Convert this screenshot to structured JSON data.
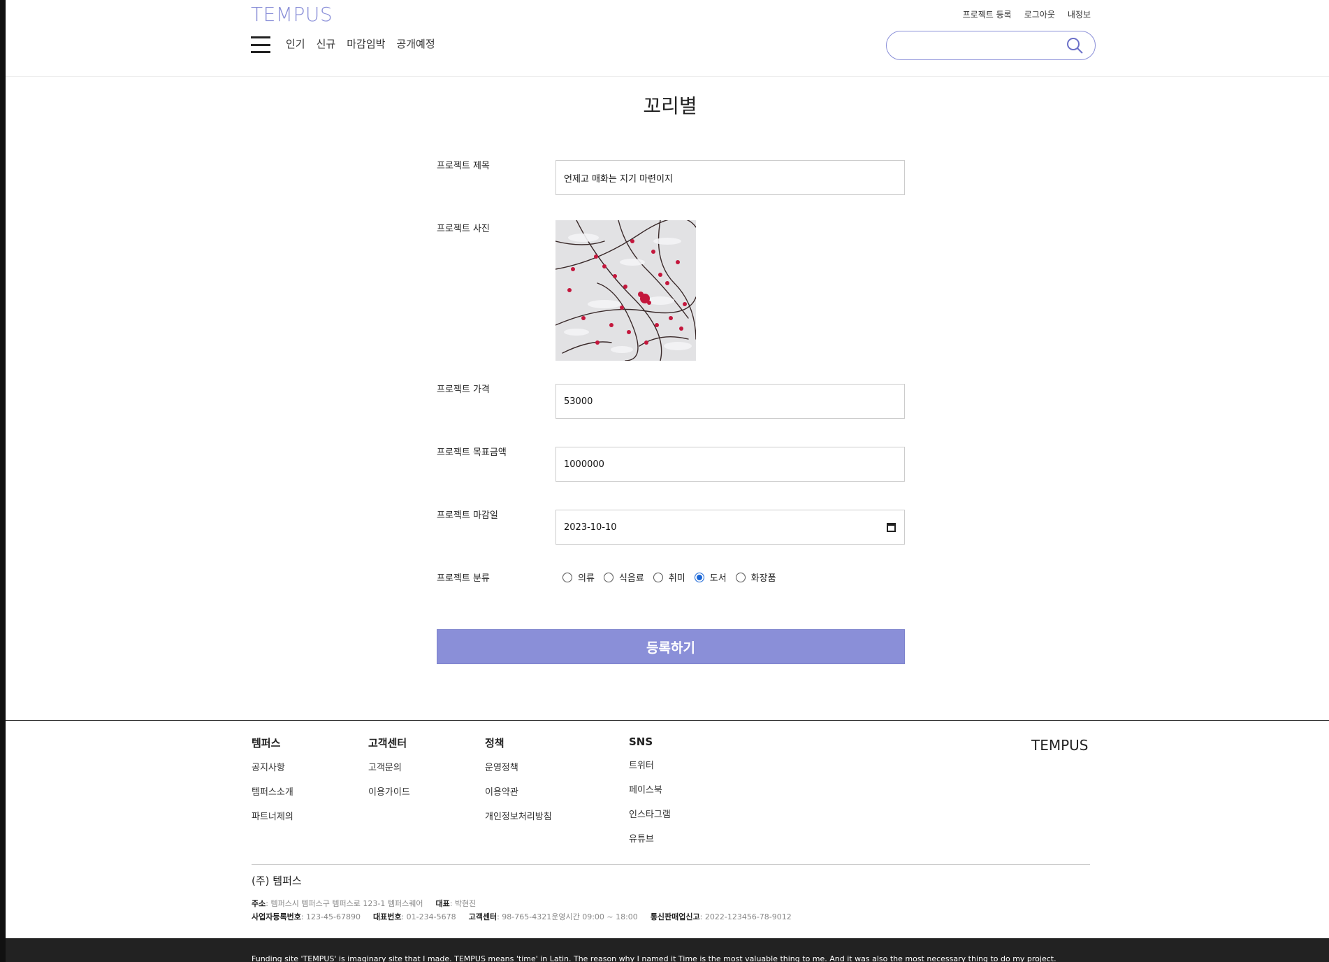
{
  "header": {
    "logo": "TEMPUS",
    "util_links": [
      "프로젝트 등록",
      "로그아웃",
      "내정보"
    ],
    "nav": [
      "인기",
      "신규",
      "마감임박",
      "공개예정"
    ],
    "search_placeholder": ""
  },
  "form": {
    "page_title": "꼬리별",
    "title_label": "프로젝트 제목",
    "title_value": "언제고 매화는 지기 마련이지",
    "photo_label": "프로젝트 사진",
    "price_label": "프로젝트 가격",
    "price_value": "53000",
    "goal_label": "프로젝트 목표금액",
    "goal_value": "1000000",
    "deadline_label": "프로젝트 마감일",
    "deadline_value": "2023-10-10",
    "category_label": "프로젝트 분류",
    "categories": [
      "의류",
      "식음료",
      "취미",
      "도서",
      "화장품"
    ],
    "selected_category": "도서",
    "submit_label": "등록하기"
  },
  "footer": {
    "columns": [
      {
        "title": "템퍼스",
        "items": [
          "공지사항",
          "템퍼스소개",
          "파트너제의"
        ]
      },
      {
        "title": "고객센터",
        "items": [
          "고객문의",
          "이용가이드"
        ]
      },
      {
        "title": "정책",
        "items": [
          "운영정책",
          "이용약관",
          "개인정보처리방침"
        ]
      },
      {
        "title": "SNS",
        "items": [
          "트위터",
          "페이스북",
          "인스타그램",
          "유튜브"
        ]
      }
    ],
    "logo": "TEMPUS",
    "company": "(주) 템퍼스",
    "address_label": "주소",
    "address": ": 템퍼스시 템퍼스구 템퍼스로 123-1 템퍼스퀘어",
    "ceo_label": "대표",
    "ceo": ": 박현진",
    "biz_no_label": "사업자등록번호",
    "biz_no": ": 123-45-67890",
    "phone_label": "대표번호",
    "phone": ": 01-234-5678",
    "cs_label": "고객센터",
    "cs": ": 98-765-4321운영시간 09:00 ~ 18:00",
    "mail_order_label": "통신판매업신고",
    "mail_order": ": 2022-123456-78-9012",
    "bottom_text": "Funding site 'TEMPUS' is imaginary site that I made. TEMPUS means 'time' in Latin. The reason why I named it Time is the most valuable thing to me. And it was also the most necessary thing to do my project."
  },
  "colors": {
    "accent": "#8a8fd8",
    "radio_checked": "#1a66d6",
    "bottom_bar": "#222222"
  }
}
